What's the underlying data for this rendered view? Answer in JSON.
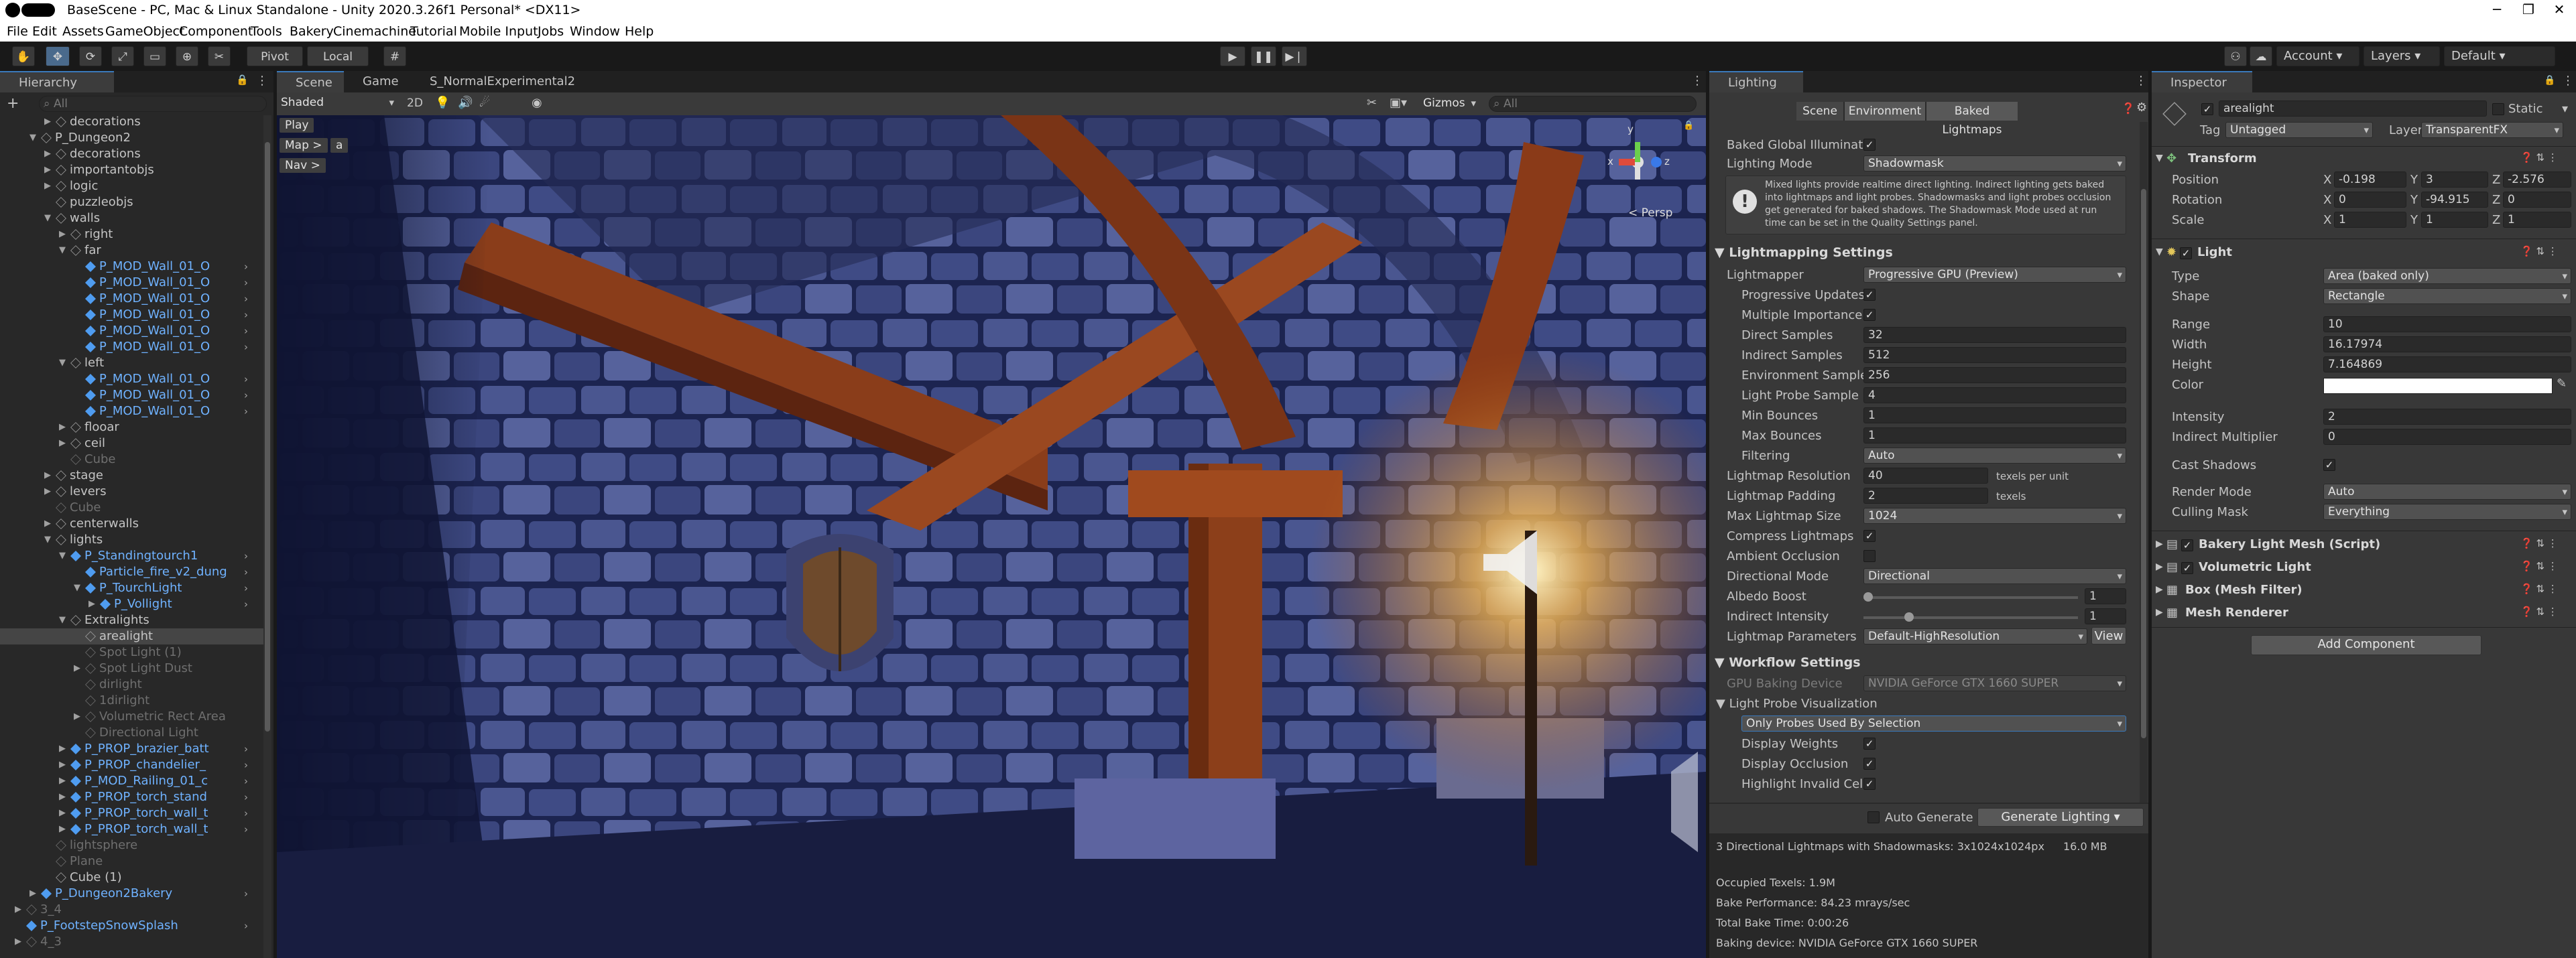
{
  "window": {
    "title": "BaseScene - PC, Mac & Linux Standalone - Unity 2020.3.26f1 Personal* <DX11>",
    "min": "─",
    "max": "❐",
    "close": "✕"
  },
  "menu": [
    "File",
    "Edit",
    "Assets",
    "GameObject",
    "Component",
    "Tools",
    "Bakery",
    "Cinemachine",
    "Tutorial",
    "Mobile Input",
    "Jobs",
    "Window",
    "Help"
  ],
  "toolbar": {
    "pivot": "Pivot",
    "local": "Local",
    "account": "Account",
    "layers": "Layers",
    "layout": "Default"
  },
  "hierarchy": {
    "tab": "Hierarchy",
    "search_placeholder": "All",
    "add": "+",
    "rows": [
      {
        "label": "decorations",
        "indent": 3,
        "tri": "▶",
        "kind": "normal"
      },
      {
        "label": "P_Dungeon2",
        "indent": 2,
        "tri": "▼",
        "kind": "normal"
      },
      {
        "label": "decorations",
        "indent": 3,
        "tri": "▶",
        "kind": "normal"
      },
      {
        "label": "importantobjs",
        "indent": 3,
        "tri": "▶",
        "kind": "normal"
      },
      {
        "label": "logic",
        "indent": 3,
        "tri": "▶",
        "kind": "normal"
      },
      {
        "label": "puzzleobjs",
        "indent": 3,
        "tri": "",
        "kind": "normal"
      },
      {
        "label": "walls",
        "indent": 3,
        "tri": "▼",
        "kind": "normal"
      },
      {
        "label": "right",
        "indent": 4,
        "tri": "▶",
        "kind": "normal"
      },
      {
        "label": "far",
        "indent": 4,
        "tri": "▼",
        "kind": "normal"
      },
      {
        "label": "P_MOD_Wall_01_O",
        "indent": 5,
        "tri": "",
        "kind": "prefab"
      },
      {
        "label": "P_MOD_Wall_01_O",
        "indent": 5,
        "tri": "",
        "kind": "prefab"
      },
      {
        "label": "P_MOD_Wall_01_O",
        "indent": 5,
        "tri": "",
        "kind": "prefab"
      },
      {
        "label": "P_MOD_Wall_01_O",
        "indent": 5,
        "tri": "",
        "kind": "prefab"
      },
      {
        "label": "P_MOD_Wall_01_O",
        "indent": 5,
        "tri": "",
        "kind": "prefab"
      },
      {
        "label": "P_MOD_Wall_01_O",
        "indent": 5,
        "tri": "",
        "kind": "prefab"
      },
      {
        "label": "left",
        "indent": 4,
        "tri": "▼",
        "kind": "normal"
      },
      {
        "label": "P_MOD_Wall_01_O",
        "indent": 5,
        "tri": "",
        "kind": "prefab"
      },
      {
        "label": "P_MOD_Wall_01_O",
        "indent": 5,
        "tri": "",
        "kind": "prefab"
      },
      {
        "label": "P_MOD_Wall_01_O",
        "indent": 5,
        "tri": "",
        "kind": "prefab"
      },
      {
        "label": "flooar",
        "indent": 4,
        "tri": "▶",
        "kind": "normal"
      },
      {
        "label": "ceil",
        "indent": 4,
        "tri": "▶",
        "kind": "normal"
      },
      {
        "label": "Cube",
        "indent": 4,
        "tri": "",
        "kind": "dim"
      },
      {
        "label": "stage",
        "indent": 3,
        "tri": "▶",
        "kind": "normal"
      },
      {
        "label": "levers",
        "indent": 3,
        "tri": "▶",
        "kind": "normal"
      },
      {
        "label": "Cube",
        "indent": 3,
        "tri": "",
        "kind": "dim"
      },
      {
        "label": "centerwalls",
        "indent": 3,
        "tri": "▶",
        "kind": "normal"
      },
      {
        "label": "lights",
        "indent": 3,
        "tri": "▼",
        "kind": "normal"
      },
      {
        "label": "P_Standingtourch1",
        "indent": 4,
        "tri": "▼",
        "kind": "prefab"
      },
      {
        "label": "Particle_fire_v2_dung",
        "indent": 5,
        "tri": "",
        "kind": "prefab"
      },
      {
        "label": "P_TourchLight",
        "indent": 5,
        "tri": "▼",
        "kind": "prefab"
      },
      {
        "label": "P_Vollight",
        "indent": 6,
        "tri": "▶",
        "kind": "prefab"
      },
      {
        "label": "Extralights",
        "indent": 4,
        "tri": "▼",
        "kind": "normal"
      },
      {
        "label": "arealight",
        "indent": 5,
        "tri": "",
        "kind": "selected"
      },
      {
        "label": "Spot Light (1)",
        "indent": 5,
        "tri": "",
        "kind": "dim"
      },
      {
        "label": "Spot Light Dust",
        "indent": 5,
        "tri": "▶",
        "kind": "dim"
      },
      {
        "label": "dirlight",
        "indent": 5,
        "tri": "",
        "kind": "dim"
      },
      {
        "label": "1dirlight",
        "indent": 5,
        "tri": "",
        "kind": "dim"
      },
      {
        "label": "Volumetric Rect Area",
        "indent": 5,
        "tri": "▶",
        "kind": "dim"
      },
      {
        "label": "Directional Light",
        "indent": 5,
        "tri": "",
        "kind": "dim"
      },
      {
        "label": "P_PROP_brazier_batt",
        "indent": 4,
        "tri": "▶",
        "kind": "prefab"
      },
      {
        "label": "P_PROP_chandelier_",
        "indent": 4,
        "tri": "▶",
        "kind": "prefab"
      },
      {
        "label": "P_MOD_Railing_01_c",
        "indent": 4,
        "tri": "▶",
        "kind": "prefab"
      },
      {
        "label": "P_PROP_torch_stand",
        "indent": 4,
        "tri": "▶",
        "kind": "prefab"
      },
      {
        "label": "P_PROP_torch_wall_t",
        "indent": 4,
        "tri": "▶",
        "kind": "prefab"
      },
      {
        "label": "P_PROP_torch_wall_t",
        "indent": 4,
        "tri": "▶",
        "kind": "prefab"
      },
      {
        "label": "lightsphere",
        "indent": 3,
        "tri": "",
        "kind": "dim"
      },
      {
        "label": "Plane",
        "indent": 3,
        "tri": "",
        "kind": "dim"
      },
      {
        "label": "Cube (1)",
        "indent": 3,
        "tri": "",
        "kind": "normal"
      },
      {
        "label": "P_Dungeon2Bakery",
        "indent": 2,
        "tri": "▶",
        "kind": "prefab"
      },
      {
        "label": "3_4",
        "indent": 1,
        "tri": "▶",
        "kind": "dim"
      },
      {
        "label": "P_FootstepSnowSplash",
        "indent": 1,
        "tri": "",
        "kind": "prefab"
      },
      {
        "label": "4_3",
        "indent": 1,
        "tri": "▶",
        "kind": "dim"
      }
    ]
  },
  "scene": {
    "tabs": [
      "Scene",
      "Game",
      "S_NormalExperimental2"
    ],
    "shading": "Shaded",
    "mode2d": "2D",
    "gizmos": "Gizmos",
    "search_placeholder": "All",
    "play_btn": "Play",
    "map_btn": "Map >",
    "map_a": "a",
    "nav_btn": "Nav >",
    "persp": "< Persp",
    "axis": {
      "x": "x",
      "y": "y",
      "z": "z"
    }
  },
  "lighting": {
    "tab": "Lighting",
    "subtabs": [
      "Scene",
      "Environment",
      "Baked Lightmaps"
    ],
    "baked_gi_label": "Baked Global Illuminati",
    "lighting_mode_label": "Lighting Mode",
    "lighting_mode": "Shadowmask",
    "info": "Mixed lights provide realtime direct lighting. Indirect lighting gets baked into lightmaps and light probes. Shadowmasks and light probes occlusion get generated for baked shadows. The Shadowmask Mode used at run time can be set in the Quality Settings panel.",
    "lightmapping_header": "Lightmapping Settings",
    "lightmapper_label": "Lightmapper",
    "lightmapper": "Progressive GPU (Preview)",
    "progressive_label": "Progressive Updates",
    "multiple_label": "Multiple Importance",
    "direct_samples_label": "Direct Samples",
    "direct_samples": "32",
    "indirect_samples_label": "Indirect Samples",
    "indirect_samples": "512",
    "env_samples_label": "Environment Sample",
    "env_samples": "256",
    "probe_samples_label": "Light Probe Sample M",
    "probe_samples": "4",
    "min_bounces_label": "Min Bounces",
    "min_bounces": "1",
    "max_bounces_label": "Max Bounces",
    "max_bounces": "1",
    "filtering_label": "Filtering",
    "filtering": "Auto",
    "resolution_label": "Lightmap Resolution",
    "resolution": "40",
    "texels_per_unit": "texels per unit",
    "padding_label": "Lightmap Padding",
    "padding": "2",
    "texels": "texels",
    "max_size_label": "Max Lightmap Size",
    "max_size": "1024",
    "compress_label": "Compress Lightmaps",
    "ao_label": "Ambient Occlusion",
    "dir_mode_label": "Directional Mode",
    "dir_mode": "Directional",
    "albedo_label": "Albedo Boost",
    "albedo": "1",
    "albedo_fraction": 0.0,
    "indirect_label": "Indirect Intensity",
    "indirect": "1",
    "indirect_fraction": 0.2,
    "params_label": "Lightmap Parameters",
    "params": "Default-HighResolution",
    "view_btn": "View",
    "workflow_header": "Workflow Settings",
    "gpu_device_label": "GPU Baking Device",
    "gpu_device": "NVIDIA GeForce GTX 1660 SUPER",
    "probe_vis_label": "Light Probe Visualization",
    "probe_vis": "Only Probes Used By Selection",
    "display_weights": "Display Weights",
    "display_occlusion": "Display Occlusion",
    "highlight_invalid": "Highlight Invalid Cell",
    "auto_generate": "Auto Generate",
    "generate_btn": "Generate Lighting",
    "stats_line": "3 Directional Lightmaps with Shadowmasks: 3x1024x1024px",
    "stats_size": "16.0 MB",
    "occupied": "Occupied Texels: 1.9M",
    "bake_perf": "Bake Performance: 84.23 mrays/sec",
    "bake_time": "Total Bake Time: 0:00:26",
    "bake_device": "Baking device: NVIDIA GeForce GTX 1660 SUPER"
  },
  "inspector": {
    "tab": "Inspector",
    "name": "arealight",
    "static_label": "Static",
    "tag_label": "Tag",
    "tag": "Untagged",
    "layer_label": "Layer",
    "layer": "TransparentFX",
    "transform_header": "Transform",
    "position_label": "Position",
    "rotation_label": "Rotation",
    "scale_label": "Scale",
    "pos": {
      "x": "-0.198",
      "y": "3",
      "z": "-2.576"
    },
    "rot": {
      "x": "0",
      "y": "-94.915",
      "z": "0"
    },
    "scl": {
      "x": "1",
      "y": "1",
      "z": "1"
    },
    "light_header": "Light",
    "type_label": "Type",
    "type": "Area (baked only)",
    "shape_label": "Shape",
    "shape": "Rectangle",
    "range_label": "Range",
    "range": "10",
    "width_label": "Width",
    "width": "16.17974",
    "height_label": "Height",
    "height": "7.164869",
    "color_label": "Color",
    "light_color": "#ffffff",
    "intensity_label": "Intensity",
    "intensity": "2",
    "indirect_mult_label": "Indirect Multiplier",
    "indirect_mult": "0",
    "cast_shadows_label": "Cast Shadows",
    "render_mode_label": "Render Mode",
    "render_mode": "Auto",
    "culling_label": "Culling Mask",
    "culling": "Everything",
    "components": [
      "Bakery Light Mesh (Script)",
      "Volumetric Light",
      "Box (Mesh Filter)",
      "Mesh Renderer"
    ],
    "add_component": "Add Component"
  },
  "colors": {
    "accent": "#3a79bb",
    "prefab": "#6fb2ff",
    "panel": "#282828"
  }
}
